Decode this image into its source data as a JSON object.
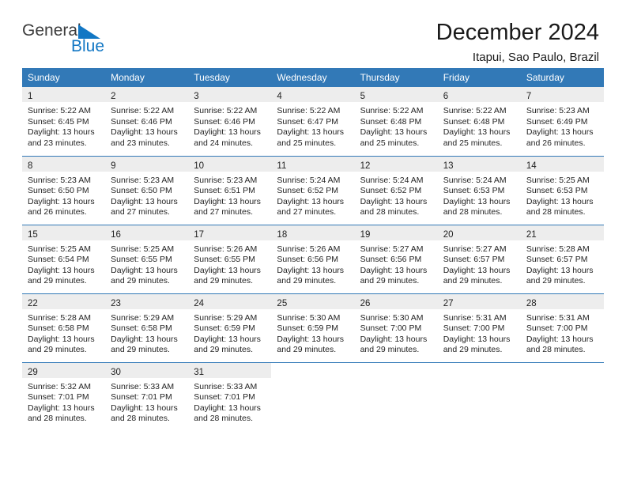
{
  "brand": {
    "name_part1": "General",
    "name_part2": "Blue",
    "triangle_icon": "brand-triangle-icon",
    "accent_color": "#1277c4"
  },
  "header": {
    "title": "December 2024",
    "location": "Itapui, Sao Paulo, Brazil"
  },
  "theme": {
    "header_blue": "#3279b7",
    "daynum_gray": "#ededed",
    "text": "#242424"
  },
  "weekdays": [
    "Sunday",
    "Monday",
    "Tuesday",
    "Wednesday",
    "Thursday",
    "Friday",
    "Saturday"
  ],
  "labels": {
    "sunrise_prefix": "Sunrise:",
    "sunset_prefix": "Sunset:",
    "daylight_prefix": "Daylight:"
  },
  "weeks": [
    [
      {
        "day": "1",
        "sunrise": "Sunrise: 5:22 AM",
        "sunset": "Sunset: 6:45 PM",
        "daylight_line1": "Daylight: 13 hours",
        "daylight_line2": "and 23 minutes."
      },
      {
        "day": "2",
        "sunrise": "Sunrise: 5:22 AM",
        "sunset": "Sunset: 6:46 PM",
        "daylight_line1": "Daylight: 13 hours",
        "daylight_line2": "and 23 minutes."
      },
      {
        "day": "3",
        "sunrise": "Sunrise: 5:22 AM",
        "sunset": "Sunset: 6:46 PM",
        "daylight_line1": "Daylight: 13 hours",
        "daylight_line2": "and 24 minutes."
      },
      {
        "day": "4",
        "sunrise": "Sunrise: 5:22 AM",
        "sunset": "Sunset: 6:47 PM",
        "daylight_line1": "Daylight: 13 hours",
        "daylight_line2": "and 25 minutes."
      },
      {
        "day": "5",
        "sunrise": "Sunrise: 5:22 AM",
        "sunset": "Sunset: 6:48 PM",
        "daylight_line1": "Daylight: 13 hours",
        "daylight_line2": "and 25 minutes."
      },
      {
        "day": "6",
        "sunrise": "Sunrise: 5:22 AM",
        "sunset": "Sunset: 6:48 PM",
        "daylight_line1": "Daylight: 13 hours",
        "daylight_line2": "and 25 minutes."
      },
      {
        "day": "7",
        "sunrise": "Sunrise: 5:23 AM",
        "sunset": "Sunset: 6:49 PM",
        "daylight_line1": "Daylight: 13 hours",
        "daylight_line2": "and 26 minutes."
      }
    ],
    [
      {
        "day": "8",
        "sunrise": "Sunrise: 5:23 AM",
        "sunset": "Sunset: 6:50 PM",
        "daylight_line1": "Daylight: 13 hours",
        "daylight_line2": "and 26 minutes."
      },
      {
        "day": "9",
        "sunrise": "Sunrise: 5:23 AM",
        "sunset": "Sunset: 6:50 PM",
        "daylight_line1": "Daylight: 13 hours",
        "daylight_line2": "and 27 minutes."
      },
      {
        "day": "10",
        "sunrise": "Sunrise: 5:23 AM",
        "sunset": "Sunset: 6:51 PM",
        "daylight_line1": "Daylight: 13 hours",
        "daylight_line2": "and 27 minutes."
      },
      {
        "day": "11",
        "sunrise": "Sunrise: 5:24 AM",
        "sunset": "Sunset: 6:52 PM",
        "daylight_line1": "Daylight: 13 hours",
        "daylight_line2": "and 27 minutes."
      },
      {
        "day": "12",
        "sunrise": "Sunrise: 5:24 AM",
        "sunset": "Sunset: 6:52 PM",
        "daylight_line1": "Daylight: 13 hours",
        "daylight_line2": "and 28 minutes."
      },
      {
        "day": "13",
        "sunrise": "Sunrise: 5:24 AM",
        "sunset": "Sunset: 6:53 PM",
        "daylight_line1": "Daylight: 13 hours",
        "daylight_line2": "and 28 minutes."
      },
      {
        "day": "14",
        "sunrise": "Sunrise: 5:25 AM",
        "sunset": "Sunset: 6:53 PM",
        "daylight_line1": "Daylight: 13 hours",
        "daylight_line2": "and 28 minutes."
      }
    ],
    [
      {
        "day": "15",
        "sunrise": "Sunrise: 5:25 AM",
        "sunset": "Sunset: 6:54 PM",
        "daylight_line1": "Daylight: 13 hours",
        "daylight_line2": "and 29 minutes."
      },
      {
        "day": "16",
        "sunrise": "Sunrise: 5:25 AM",
        "sunset": "Sunset: 6:55 PM",
        "daylight_line1": "Daylight: 13 hours",
        "daylight_line2": "and 29 minutes."
      },
      {
        "day": "17",
        "sunrise": "Sunrise: 5:26 AM",
        "sunset": "Sunset: 6:55 PM",
        "daylight_line1": "Daylight: 13 hours",
        "daylight_line2": "and 29 minutes."
      },
      {
        "day": "18",
        "sunrise": "Sunrise: 5:26 AM",
        "sunset": "Sunset: 6:56 PM",
        "daylight_line1": "Daylight: 13 hours",
        "daylight_line2": "and 29 minutes."
      },
      {
        "day": "19",
        "sunrise": "Sunrise: 5:27 AM",
        "sunset": "Sunset: 6:56 PM",
        "daylight_line1": "Daylight: 13 hours",
        "daylight_line2": "and 29 minutes."
      },
      {
        "day": "20",
        "sunrise": "Sunrise: 5:27 AM",
        "sunset": "Sunset: 6:57 PM",
        "daylight_line1": "Daylight: 13 hours",
        "daylight_line2": "and 29 minutes."
      },
      {
        "day": "21",
        "sunrise": "Sunrise: 5:28 AM",
        "sunset": "Sunset: 6:57 PM",
        "daylight_line1": "Daylight: 13 hours",
        "daylight_line2": "and 29 minutes."
      }
    ],
    [
      {
        "day": "22",
        "sunrise": "Sunrise: 5:28 AM",
        "sunset": "Sunset: 6:58 PM",
        "daylight_line1": "Daylight: 13 hours",
        "daylight_line2": "and 29 minutes."
      },
      {
        "day": "23",
        "sunrise": "Sunrise: 5:29 AM",
        "sunset": "Sunset: 6:58 PM",
        "daylight_line1": "Daylight: 13 hours",
        "daylight_line2": "and 29 minutes."
      },
      {
        "day": "24",
        "sunrise": "Sunrise: 5:29 AM",
        "sunset": "Sunset: 6:59 PM",
        "daylight_line1": "Daylight: 13 hours",
        "daylight_line2": "and 29 minutes."
      },
      {
        "day": "25",
        "sunrise": "Sunrise: 5:30 AM",
        "sunset": "Sunset: 6:59 PM",
        "daylight_line1": "Daylight: 13 hours",
        "daylight_line2": "and 29 minutes."
      },
      {
        "day": "26",
        "sunrise": "Sunrise: 5:30 AM",
        "sunset": "Sunset: 7:00 PM",
        "daylight_line1": "Daylight: 13 hours",
        "daylight_line2": "and 29 minutes."
      },
      {
        "day": "27",
        "sunrise": "Sunrise: 5:31 AM",
        "sunset": "Sunset: 7:00 PM",
        "daylight_line1": "Daylight: 13 hours",
        "daylight_line2": "and 29 minutes."
      },
      {
        "day": "28",
        "sunrise": "Sunrise: 5:31 AM",
        "sunset": "Sunset: 7:00 PM",
        "daylight_line1": "Daylight: 13 hours",
        "daylight_line2": "and 28 minutes."
      }
    ],
    [
      {
        "day": "29",
        "sunrise": "Sunrise: 5:32 AM",
        "sunset": "Sunset: 7:01 PM",
        "daylight_line1": "Daylight: 13 hours",
        "daylight_line2": "and 28 minutes."
      },
      {
        "day": "30",
        "sunrise": "Sunrise: 5:33 AM",
        "sunset": "Sunset: 7:01 PM",
        "daylight_line1": "Daylight: 13 hours",
        "daylight_line2": "and 28 minutes."
      },
      {
        "day": "31",
        "sunrise": "Sunrise: 5:33 AM",
        "sunset": "Sunset: 7:01 PM",
        "daylight_line1": "Daylight: 13 hours",
        "daylight_line2": "and 28 minutes."
      },
      {
        "day": "",
        "sunrise": "",
        "sunset": "",
        "daylight_line1": "",
        "daylight_line2": ""
      },
      {
        "day": "",
        "sunrise": "",
        "sunset": "",
        "daylight_line1": "",
        "daylight_line2": ""
      },
      {
        "day": "",
        "sunrise": "",
        "sunset": "",
        "daylight_line1": "",
        "daylight_line2": ""
      },
      {
        "day": "",
        "sunrise": "",
        "sunset": "",
        "daylight_line1": "",
        "daylight_line2": ""
      }
    ]
  ]
}
